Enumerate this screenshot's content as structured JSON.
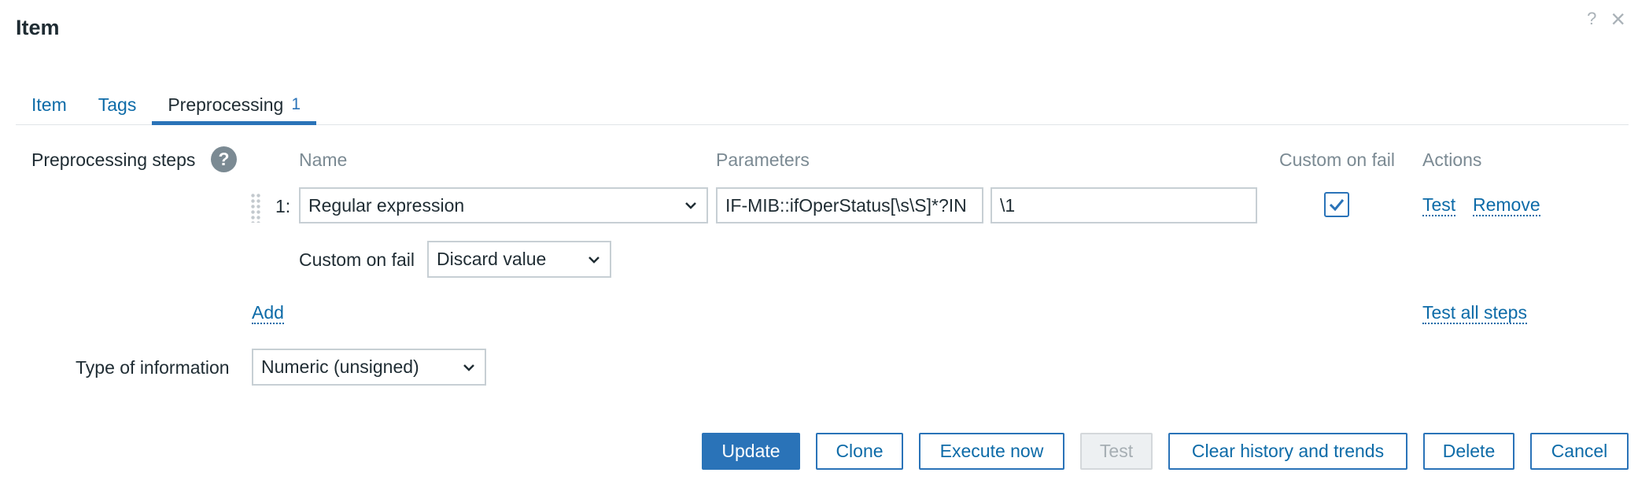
{
  "window": {
    "title": "Item",
    "help_glyph": "?",
    "close_glyph": "×"
  },
  "tabs": [
    {
      "label": "Item"
    },
    {
      "label": "Tags"
    },
    {
      "label": "Preprocessing",
      "badge": "1"
    }
  ],
  "preprocessing": {
    "steps_label": "Preprocessing steps",
    "help_glyph": "?",
    "columns": {
      "name": "Name",
      "parameters": "Parameters",
      "custom_on_fail": "Custom on fail",
      "actions": "Actions"
    },
    "steps": [
      {
        "number": "1:",
        "name": "Regular expression",
        "param1": "IF-MIB::ifOperStatus[\\s\\S]*?IN",
        "param2": "\\1",
        "custom_on_fail_checked": true,
        "custom_on_fail_label": "Custom on fail",
        "custom_on_fail_value": "Discard value",
        "actions": {
          "test": "Test",
          "remove": "Remove"
        }
      }
    ],
    "add_label": "Add",
    "test_all_label": "Test all steps"
  },
  "type_of_information": {
    "label": "Type of information",
    "value": "Numeric (unsigned)"
  },
  "buttons": {
    "update": "Update",
    "clone": "Clone",
    "execute_now": "Execute now",
    "test": "Test",
    "clear_history": "Clear history and trends",
    "delete": "Delete",
    "cancel": "Cancel"
  },
  "colors": {
    "accent": "#2a73b8",
    "link": "#0d6ba8",
    "muted": "#7b8a93"
  },
  "icons": {
    "help": "help-icon",
    "close": "close-icon",
    "chevron": "chevron-down-icon",
    "check": "checkmark-icon",
    "drag": "drag-handle-icon"
  }
}
